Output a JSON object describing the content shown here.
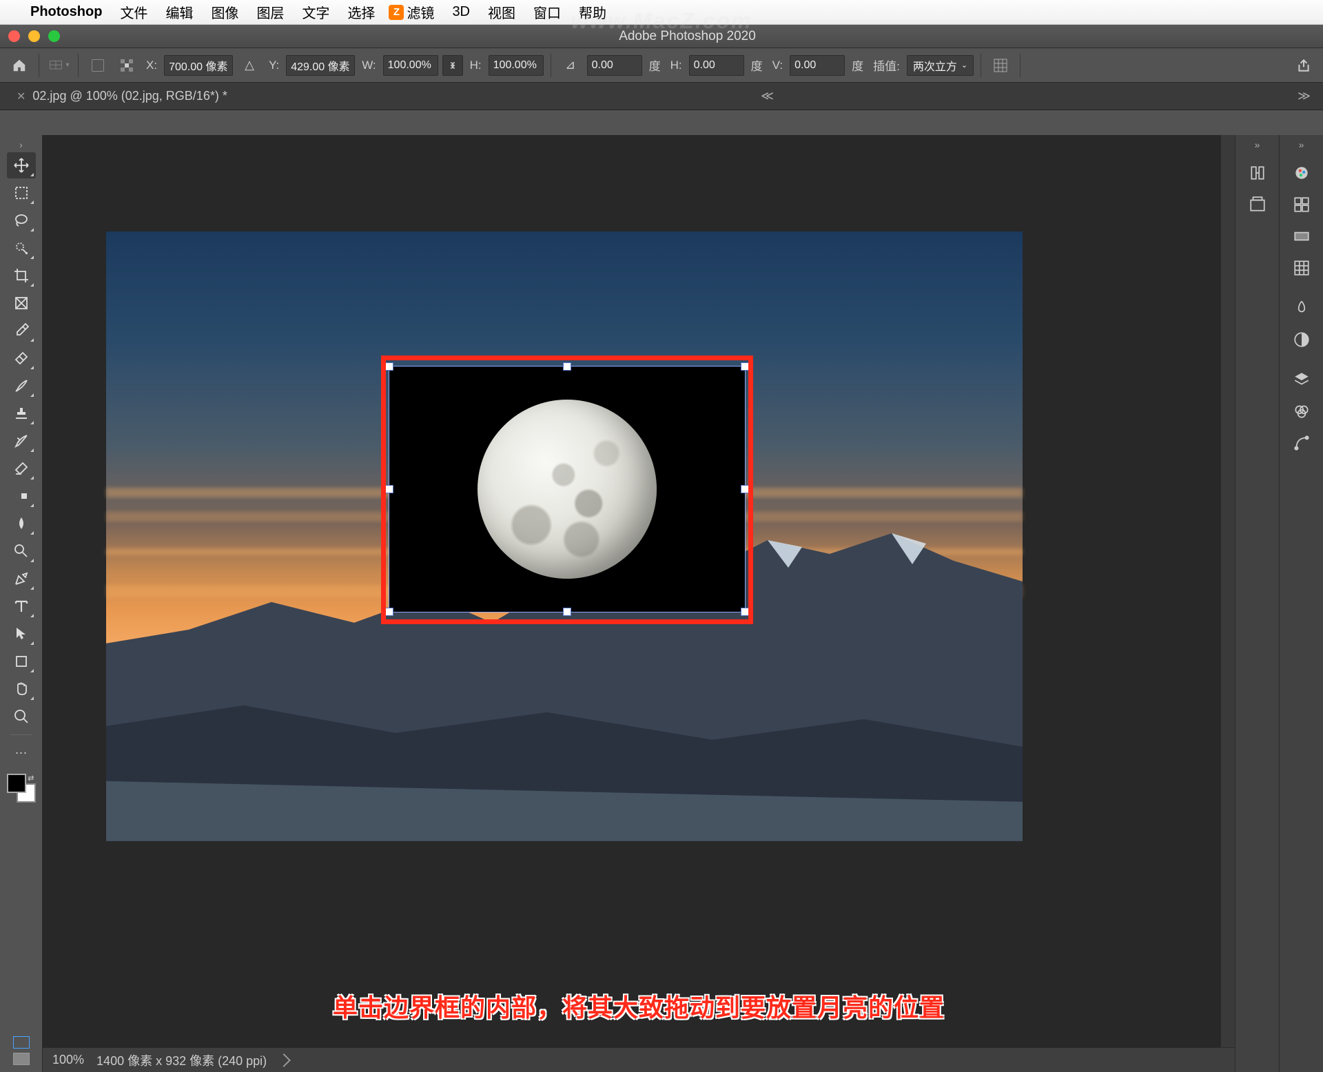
{
  "mac_menu": {
    "app_name": "Photoshop",
    "items": [
      "文件",
      "编辑",
      "图像",
      "图层",
      "文字",
      "选择",
      "滤镜",
      "3D",
      "视图",
      "窗口",
      "帮助"
    ]
  },
  "watermark": "www.MacZ.com",
  "window": {
    "title": "Adobe Photoshop 2020"
  },
  "options_bar": {
    "x_label": "X:",
    "x_value": "700.00 像素",
    "y_label": "Y:",
    "y_value": "429.00 像素",
    "w_label": "W:",
    "w_value": "100.00%",
    "h_label": "H:",
    "h_value": "100.00%",
    "angle_value": "0.00",
    "angle_unit": "度",
    "h_skew_label": "H:",
    "h_skew_value": "0.00",
    "h_skew_unit": "度",
    "v_skew_label": "V:",
    "v_skew_value": "0.00",
    "v_skew_unit": "度",
    "interp_label": "插值:",
    "interp_value": "两次立方"
  },
  "tab": {
    "label": "02.jpg @ 100% (02.jpg, RGB/16*) *"
  },
  "instruction_text": "单击边界框的内部，将其大致拖动到要放置月亮的位置",
  "status_bar": {
    "zoom": "100%",
    "doc_info": "1400 像素 x 932 像素 (240 ppi)"
  },
  "icons": {
    "home": "⌂",
    "chain": "⬚",
    "share": "⇪"
  }
}
